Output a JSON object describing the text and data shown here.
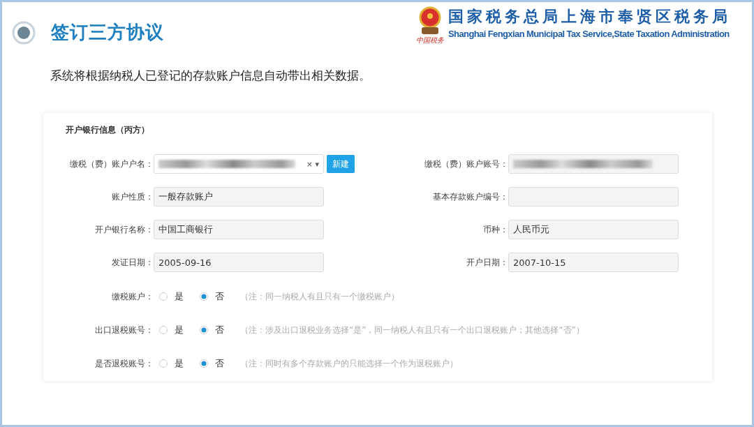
{
  "header": {
    "title": "签订三方协议",
    "org_name_cn": "国家税务总局上海市奉贤区税务局",
    "org_name_en": "Shanghai Fengxian Municipal Tax Service,State Taxation Administration",
    "logo_caption": "中国税务"
  },
  "description": "系统将根据纳税人已登记的存款账户信息自动带出相关数据。",
  "form": {
    "section_title": "开户银行信息（丙方）",
    "fields": [
      {
        "label": "缴税（费）账户户名：",
        "kind": "select",
        "redacted": true,
        "clear": "×",
        "caret": "▾",
        "button": "新建"
      },
      {
        "label": "缴税（费）账户账号：",
        "kind": "text",
        "redacted": true
      },
      {
        "label": "账户性质：",
        "kind": "text",
        "redacted": false,
        "value": "一般存款账户"
      },
      {
        "label": "基本存款账户编号：",
        "kind": "text",
        "redacted": false
      },
      {
        "label": "开户银行名称：",
        "kind": "text",
        "redacted": false,
        "value": "中国工商银行"
      },
      {
        "label": "币种：",
        "kind": "text",
        "redacted": false,
        "value": "人民币元"
      },
      {
        "label": "发证日期：",
        "kind": "text",
        "redacted": false,
        "value": "2005-09-16"
      },
      {
        "label": "开户日期：",
        "kind": "text",
        "redacted": false,
        "value": "2007-10-15"
      }
    ],
    "radio_rows": [
      {
        "label": "缴税账户：",
        "options": [
          {
            "label": "是",
            "selected": false
          },
          {
            "label": "否",
            "selected": true
          }
        ],
        "note": "（注：同一纳税人有且只有一个缴税账户）"
      },
      {
        "label": "出口退税账号：",
        "options": [
          {
            "label": "是",
            "selected": false
          },
          {
            "label": "否",
            "selected": true
          }
        ],
        "note": "（注：涉及出口退税业务选择“是”，同一纳税人有且只有一个出口退税账户；其他选择“否”）"
      },
      {
        "label": "是否退税账号：",
        "options": [
          {
            "label": "是",
            "selected": false
          },
          {
            "label": "否",
            "selected": true
          }
        ],
        "note": "（注：同时有多个存款账户的只能选择一个作为退税账户）"
      }
    ]
  }
}
